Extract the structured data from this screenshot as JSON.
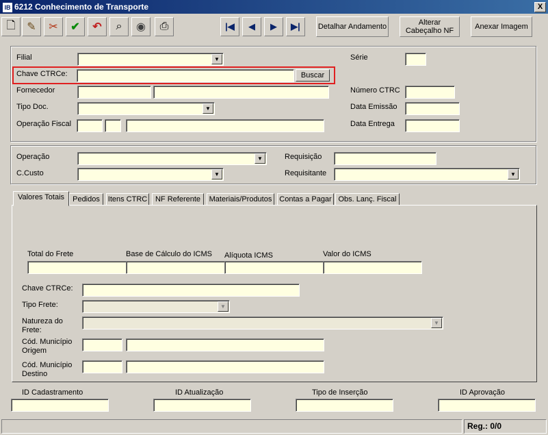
{
  "window": {
    "title": "6212 Conhecimento de Transporte",
    "close": "X",
    "app_icon": "IB"
  },
  "toolbar": {
    "icons": {
      "new": "🗋",
      "edit": "✎",
      "delete": "✂",
      "save": "✔",
      "undo": "↶",
      "search": "⌕",
      "disk": "◉",
      "print": "⎙",
      "first": "|◀",
      "prev": "◀",
      "next": "▶",
      "last": "▶|"
    },
    "detalhar": "Detalhar Andamento",
    "alterar": "Alterar Cabeçalho NF",
    "anexar": "Anexar Imagem"
  },
  "header": {
    "filial": "Filial",
    "serie": "Série",
    "chave": "Chave CTRCe:",
    "buscar": "Buscar",
    "fornecedor": "Fornecedor",
    "numero_ctrc": "Número CTRC",
    "tipo_doc": "Tipo Doc.",
    "data_emissao": "Data Emissão",
    "operacao_fiscal": "Operação Fiscal",
    "data_entrega": "Data Entrega"
  },
  "op": {
    "operacao": "Operação",
    "requisicao": "Requisição",
    "ccusto": "C.Custo",
    "requisitante": "Requisitante"
  },
  "tabs": [
    "Valores Totais",
    "Pedidos",
    "Itens CTRC",
    "NF Referente",
    "Materiais/Produtos",
    "Contas a Pagar",
    "Obs. Lanç. Fiscal"
  ],
  "totais": {
    "total_frete": "Total do  Frete",
    "base_icms": "Base de Cálculo do ICMS",
    "aliquota": "Alíquota ICMS",
    "valor_icms": "Valor do ICMS",
    "chave": "Chave CTRCe:",
    "tipo_frete": "Tipo Frete:",
    "natureza_1": "Natureza do",
    "natureza_2": "Frete:",
    "mun_origem_1": "Cód. Município",
    "mun_origem_2": "Origem",
    "mun_destino_1": "Cód. Município",
    "mun_destino_2": "Destino"
  },
  "ids": {
    "cadastramento": "ID Cadastramento",
    "atualizacao": "ID Atualização",
    "tipo_insercao": "Tipo de Inserção",
    "aprovacao": "ID Aprovação"
  },
  "status": {
    "reg": "Reg.: 0/0"
  }
}
